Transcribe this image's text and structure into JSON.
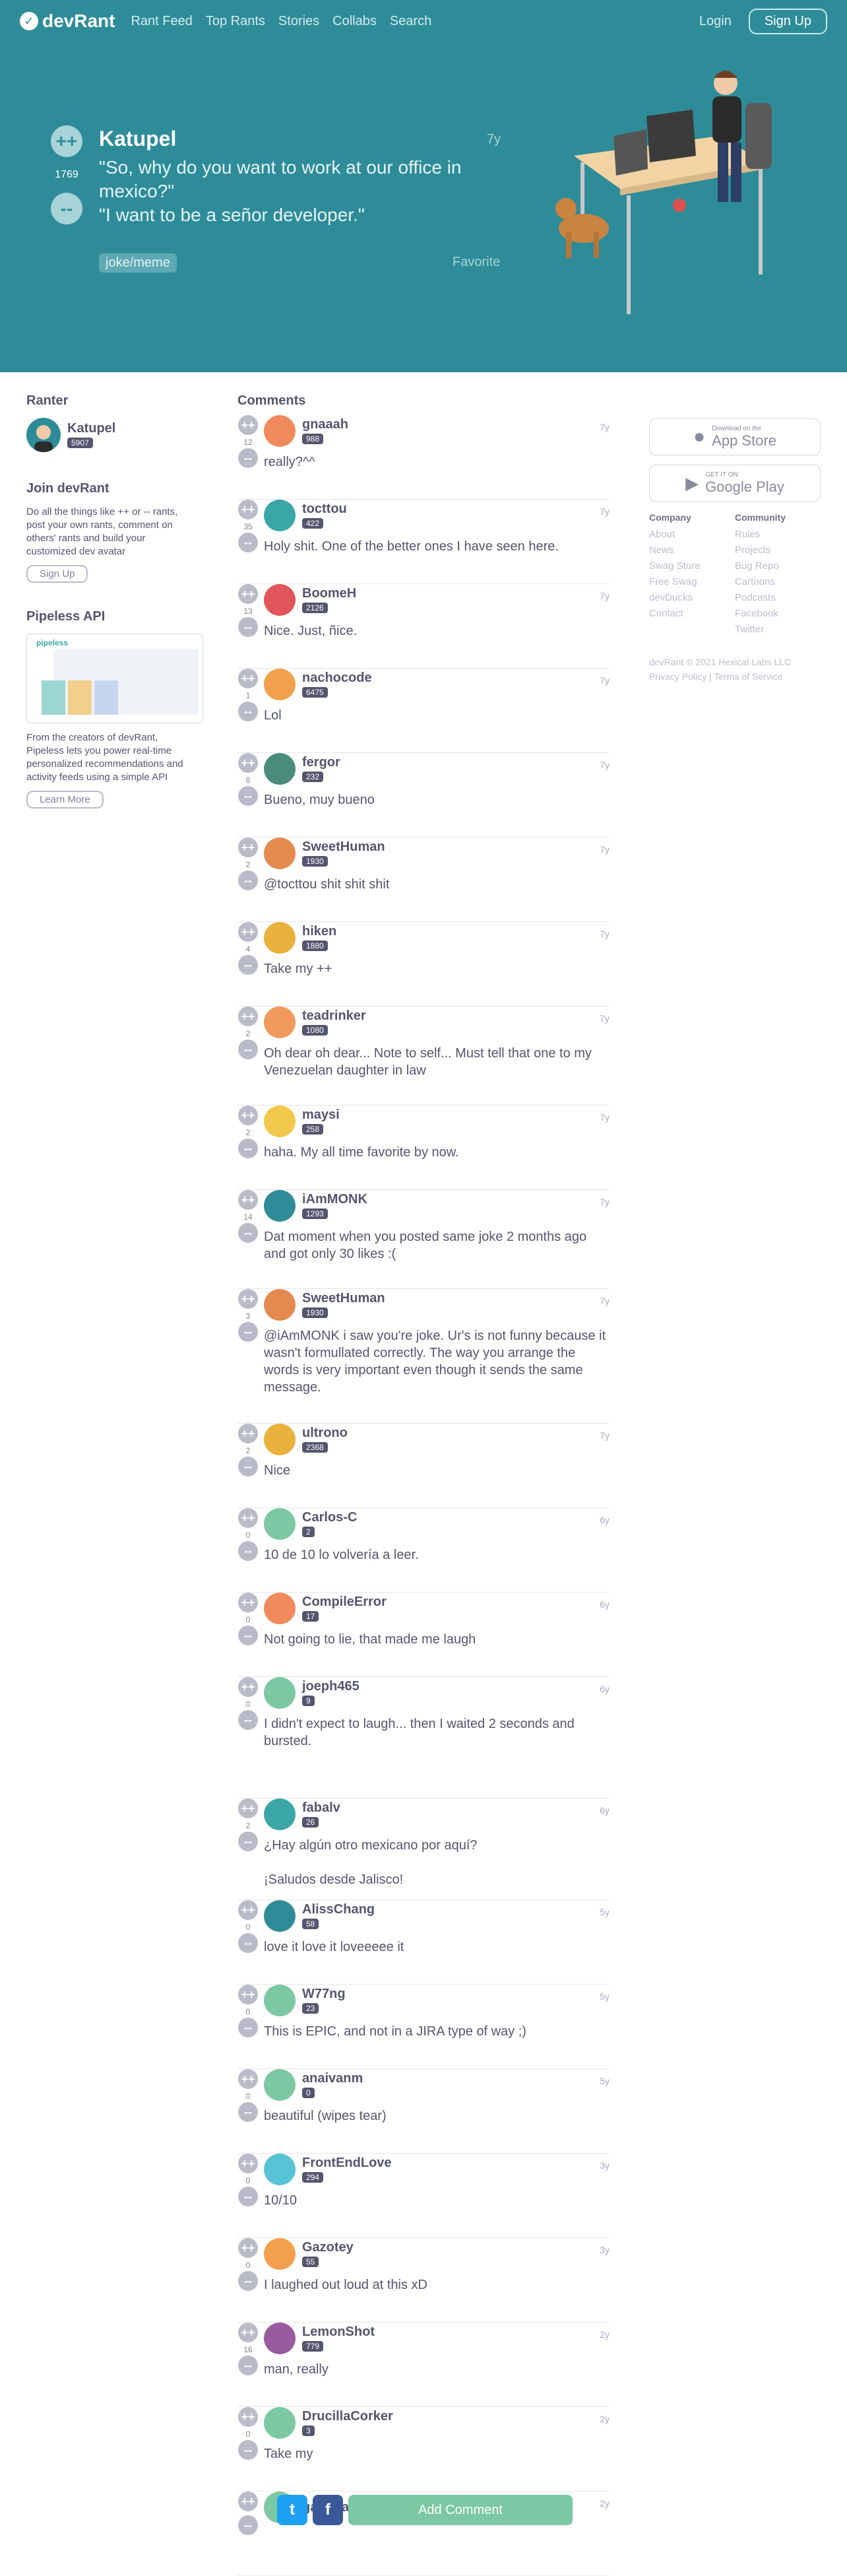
{
  "nav": {
    "logo": "devRant",
    "links": [
      "Rant Feed",
      "Top Rants",
      "Stories",
      "Collabs",
      "Search"
    ],
    "login": "Login",
    "signup": "Sign Up"
  },
  "rant": {
    "username": "Katupel",
    "score": "1769",
    "time": "7y",
    "text": "\"So, why do you want to work at our office in mexico?\"\n\"I want to be a señor developer.\"",
    "tag": "joke/meme",
    "favorite": "Favorite",
    "upvote": "++",
    "downvote": "--"
  },
  "left": {
    "ranter_heading": "Ranter",
    "ranter_name": "Katupel",
    "ranter_score": "5907",
    "join_heading": "Join devRant",
    "join_text": "Do all the things like ++ or -- rants, post your own rants, comment on others' rants and build your customized dev avatar",
    "join_button": "Sign Up",
    "api_heading": "Pipeless API",
    "api_logo": "pipeless",
    "api_text": "From the creators of devRant, Pipeless lets you power real-time personalized recommendations and activity feeds using a simple API",
    "api_button": "Learn More"
  },
  "comments_heading": "Comments",
  "comments": [
    {
      "user": "gnaaah",
      "score": "988",
      "votes": "12",
      "time": "7y",
      "text": "really?^^",
      "color": "#f08a5d"
    },
    {
      "user": "tocttou",
      "score": "422",
      "votes": "35",
      "time": "7y",
      "text": "Holy shit. One of the better ones I have seen here.",
      "color": "#3aa6a6"
    },
    {
      "user": "BoomeH",
      "score": "2126",
      "votes": "13",
      "time": "7y",
      "text": "Nice. Just, ñice.",
      "color": "#e0565b"
    },
    {
      "user": "nachocode",
      "score": "6475",
      "votes": "1",
      "time": "7y",
      "text": "Lol",
      "color": "#f2a04c"
    },
    {
      "user": "fergor",
      "score": "232",
      "votes": "6",
      "time": "7y",
      "text": "Bueno, muy bueno",
      "color": "#4a8c7a"
    },
    {
      "user": "SweetHuman",
      "score": "1930",
      "votes": "2",
      "time": "7y",
      "text": "@tocttou shit shit shit",
      "color": "#e4894f"
    },
    {
      "user": "hiken",
      "score": "1880",
      "votes": "4",
      "time": "7y",
      "text": "Take my ++",
      "color": "#e8b23c"
    },
    {
      "user": "teadrinker",
      "score": "1080",
      "votes": "2",
      "time": "7y",
      "text": "Oh dear oh dear... Note to self... Must tell that one to my Venezuelan daughter in law",
      "color": "#f09a5d"
    },
    {
      "user": "maysi",
      "score": "258",
      "votes": "2",
      "time": "7y",
      "text": "\u0000 haha. My all time favorite by now.",
      "color": "#f2c94c"
    },
    {
      "user": "iAmMONK",
      "score": "1293",
      "votes": "14",
      "time": "7y",
      "text": "Dat moment when you posted same joke 2 months ago and got only 30 likes :(",
      "color": "#2e8c99"
    },
    {
      "user": "SweetHuman",
      "score": "1930",
      "votes": "3",
      "time": "7y",
      "text": "@iAmMONK i saw you're joke. Ur's is not funny because it wasn't formullated correctly. The way you arrange the words is very important even though it sends the same message.",
      "color": "#e4894f"
    },
    {
      "user": "ultrono",
      "score": "2368",
      "votes": "2",
      "time": "7y",
      "text": "Nice",
      "color": "#e8b23c"
    },
    {
      "user": "Carlos-C",
      "score": "2",
      "votes": "0",
      "time": "6y",
      "text": "10 de 10 lo volvería a leer.",
      "color": "#7bc8a2"
    },
    {
      "user": "CompileError",
      "score": "17",
      "votes": "0",
      "time": "6y",
      "text": "Not going to lie, that made me laugh \u0000",
      "color": "#f08a5d"
    },
    {
      "user": "joeph465",
      "score": "9",
      "votes": "0",
      "time": "6y",
      "text": "I didn't expect to laugh... then I waited 2 seconds and bursted.\n\n\u0000\u0000\u0000\u0000\u0000",
      "color": "#7bc8a2"
    },
    {
      "user": "fabalv",
      "score": "26",
      "votes": "2",
      "time": "6y",
      "text": "¿Hay algún otro mexicano por aquí?\n\n¡Saludos desde Jalisco!",
      "color": "#3aa6a6"
    },
    {
      "user": "AlissChang",
      "score": "58",
      "votes": "0",
      "time": "5y",
      "text": "love it love it loveeeee it",
      "color": "#2e8c99"
    },
    {
      "user": "W77ng",
      "score": "23",
      "votes": "0",
      "time": "5y",
      "text": "This is EPIC, and not in a JIRA type of way ;)",
      "color": "#7bc8a2"
    },
    {
      "user": "anaivanm",
      "score": "0",
      "votes": "0",
      "time": "5y",
      "text": "beautiful (wipes tear)",
      "color": "#7bc8a2"
    },
    {
      "user": "FrontEndLove",
      "score": "294",
      "votes": "0",
      "time": "3y",
      "text": "10/10",
      "color": "#59c3d6"
    },
    {
      "user": "Gazotey",
      "score": "55",
      "votes": "0",
      "time": "3y",
      "text": "I laughed out loud at this xD",
      "color": "#f2a04c"
    },
    {
      "user": "LemonShot",
      "score": "779",
      "votes": "16",
      "time": "2y",
      "text": "man, really",
      "color": "#9a5b9e"
    },
    {
      "user": "DrucillaCorker",
      "score": "3",
      "votes": "0",
      "time": "2y",
      "text": "Take my",
      "color": "#7bc8a2"
    },
    {
      "user": "gayatradingco",
      "score": "",
      "votes": "",
      "time": "2y",
      "text": "",
      "color": "#7bc8a2"
    }
  ],
  "right": {
    "appstore_small": "Download on the",
    "appstore_big": "App Store",
    "play_small": "GET IT ON",
    "play_big": "Google Play",
    "company_heading": "Company",
    "company_links": [
      "About",
      "News",
      "Swag Store",
      "Free Swag",
      "devDucks",
      "Contact"
    ],
    "community_heading": "Community",
    "community_links": [
      "Rules",
      "Projects",
      "Bug Repo",
      "Cartoons",
      "Podcasts",
      "Facebook",
      "Twitter"
    ],
    "copyright": "devRant © 2021 Hexical Labs LLC",
    "privacy": "Privacy Policy",
    "terms": "Terms of Service"
  },
  "bottom": {
    "twitter": "t",
    "facebook": "f",
    "add_comment": "Add Comment"
  }
}
